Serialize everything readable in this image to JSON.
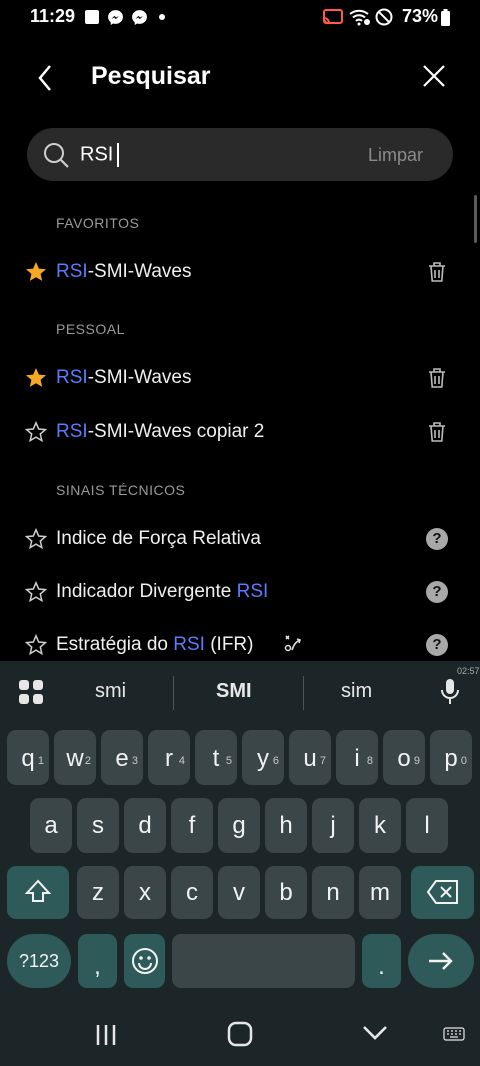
{
  "status_bar": {
    "time": "11:29",
    "battery": "73%"
  },
  "header": {
    "title": "Pesquisar"
  },
  "search": {
    "value": "RSI",
    "clear_label": "Limpar"
  },
  "sections": {
    "favorites": "FAVORITOS",
    "personal": "PESSOAL",
    "signals": "SINAIS TÉCNICOS"
  },
  "items": [
    {
      "hl": "RSI",
      "rest": "-SMI-Waves",
      "starred": true
    },
    {
      "hl": "RSI",
      "rest": "-SMI-Waves",
      "starred": true
    },
    {
      "hl": "RSI",
      "rest": "-SMI-Waves copiar 2",
      "starred": false
    }
  ],
  "signals": [
    {
      "pre": "Indice de Força Relativa",
      "hl": "",
      "post": ""
    },
    {
      "pre": "Indicador Divergente ",
      "hl": "RSI",
      "post": ""
    },
    {
      "pre": "Estratégia do ",
      "hl": "RSI",
      "post": " (IFR)"
    }
  ],
  "tiny_time": "02:57",
  "keyboard": {
    "suggestions": [
      "smi",
      "SMI",
      "sim"
    ],
    "row1": [
      [
        "q",
        "1"
      ],
      [
        "w",
        "2"
      ],
      [
        "e",
        "3"
      ],
      [
        "r",
        "4"
      ],
      [
        "t",
        "5"
      ],
      [
        "y",
        "6"
      ],
      [
        "u",
        "7"
      ],
      [
        "i",
        "8"
      ],
      [
        "o",
        "9"
      ],
      [
        "p",
        "0"
      ]
    ],
    "row2": [
      "a",
      "s",
      "d",
      "f",
      "g",
      "h",
      "j",
      "k",
      "l"
    ],
    "row3": [
      "z",
      "x",
      "c",
      "v",
      "b",
      "n",
      "m"
    ],
    "symbols_label": "?123",
    "comma": ",",
    "period": "."
  },
  "colors": {
    "accent": "#5b7bff",
    "star": "#f7a823",
    "keyboard_bg": "#1c2628",
    "key": "#3b4648"
  }
}
